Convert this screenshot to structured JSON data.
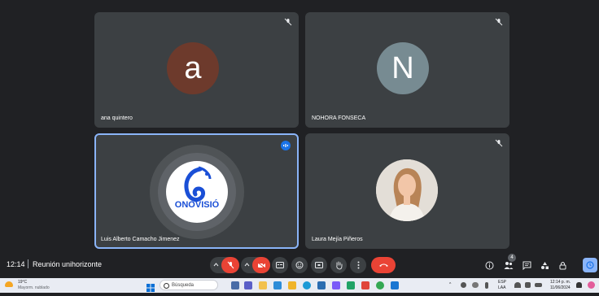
{
  "participants": [
    {
      "name": "ana quintero",
      "initial": "a",
      "avatar_color": "#6d3a2c",
      "muted": true
    },
    {
      "name": "NOHORA FONSECA",
      "initial": "N",
      "avatar_color": "#778b92",
      "muted": true
    },
    {
      "name": "Luis Alberto Camacho Jimenez",
      "logo_text": "ONOVISIÓ",
      "speaking": true
    },
    {
      "name": "Laura Mejía Piñeros",
      "muted": true
    }
  ],
  "bar": {
    "time": "12:14",
    "meeting_title": "Reunión unihorizonte",
    "participants_count": "4",
    "icons": [
      "mic-off-icon",
      "camera-off-icon",
      "captions-icon",
      "emoji-icon",
      "present-icon",
      "raise-hand-icon",
      "more-icon",
      "end-call-icon",
      "info-icon",
      "people-icon",
      "chat-icon",
      "activities-icon",
      "host-controls-icon"
    ]
  },
  "taskbar": {
    "weather_temp": "19°C",
    "weather_desc": "Mayorm. nublado",
    "search_placeholder": "Búsqueda",
    "lang_top": "ESP",
    "lang_bottom": "LAA",
    "clock_time": "12:14 p. m.",
    "clock_date": "11/06/2024"
  },
  "colors": {
    "accent": "#1a73e8",
    "end_call": "#ea4335",
    "tile_bg": "#3c4043"
  }
}
